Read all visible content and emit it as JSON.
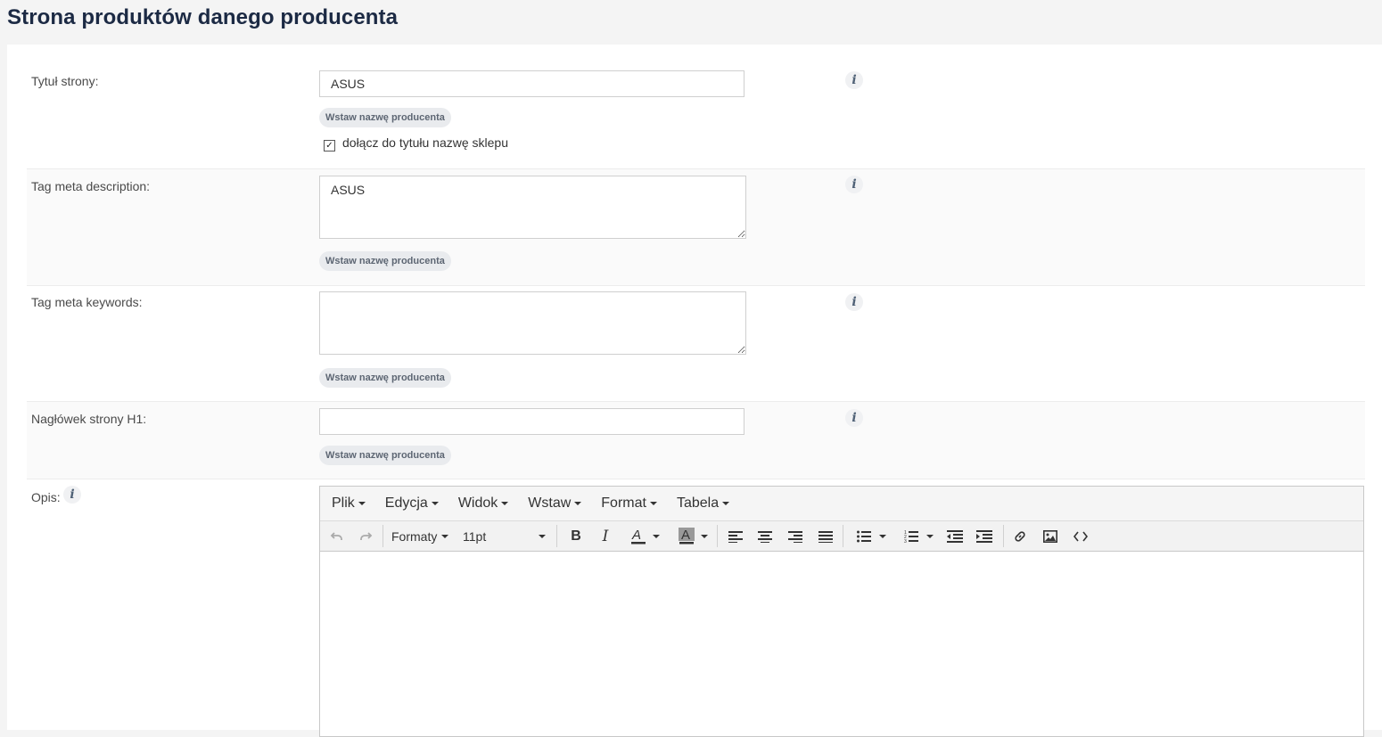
{
  "page": {
    "title": "Strona produktów danego producenta"
  },
  "fields": {
    "title": {
      "label": "Tytuł strony:",
      "value": "ASUS",
      "insert_label": "Wstaw nazwę producenta",
      "checkbox_label": "dołącz do tytułu nazwę sklepu",
      "checkbox_checked": true,
      "checkbox_mark": "✓"
    },
    "meta_description": {
      "label": "Tag meta description:",
      "value": "ASUS",
      "insert_label": "Wstaw nazwę producenta"
    },
    "meta_keywords": {
      "label": "Tag meta keywords:",
      "value": "",
      "insert_label": "Wstaw nazwę producenta"
    },
    "h1": {
      "label": "Nagłówek strony H1:",
      "value": "",
      "insert_label": "Wstaw nazwę producenta"
    },
    "description": {
      "label": "Opis:"
    }
  },
  "info_icon_glyph": "i",
  "editor": {
    "menus": [
      "Plik",
      "Edycja",
      "Widok",
      "Wstaw",
      "Format",
      "Tabela"
    ],
    "formats_label": "Formaty",
    "font_size": "11pt",
    "icons": [
      "undo-icon",
      "redo-icon",
      "bold-icon",
      "italic-icon",
      "text-color-icon",
      "background-color-icon",
      "align-left-icon",
      "align-center-icon",
      "align-right-icon",
      "align-justify-icon",
      "bullet-list-icon",
      "numbered-list-icon",
      "outdent-icon",
      "indent-icon",
      "link-icon",
      "image-icon",
      "source-code-icon"
    ]
  },
  "colors": {
    "title": "#1c2a44",
    "pill_bg": "#e9ebee",
    "info_icon": "#4f6176"
  }
}
